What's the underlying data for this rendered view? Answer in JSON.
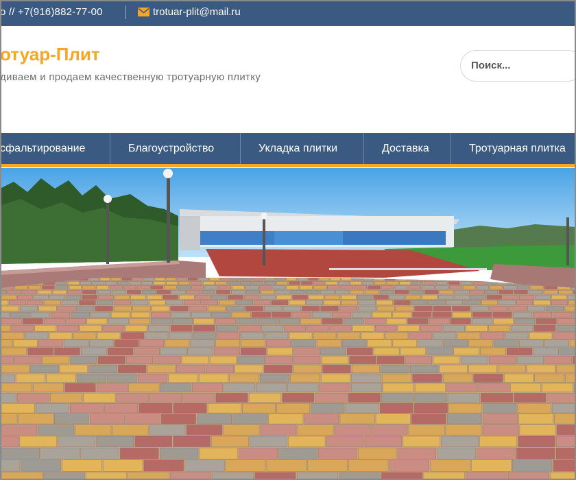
{
  "topbar": {
    "phone": "о // +7(916)882-77-00",
    "email": "trotuar-plit@mail.ru"
  },
  "header": {
    "site_title": "отуар-Плит",
    "tagline": "диваем и продаем качественную тротуарную плитку"
  },
  "search": {
    "placeholder": "Поиск..."
  },
  "nav": {
    "items": [
      {
        "label": "сфальтирование"
      },
      {
        "label": "Благоустройство"
      },
      {
        "label": "Укладка плитки"
      },
      {
        "label": "Доставка"
      },
      {
        "label": "Тротуарная плитка"
      }
    ]
  },
  "colors": {
    "brand_blue": "#3b5a82",
    "accent_orange": "#f5a623"
  },
  "hero": {
    "icon": "stadium-paving-photo"
  }
}
